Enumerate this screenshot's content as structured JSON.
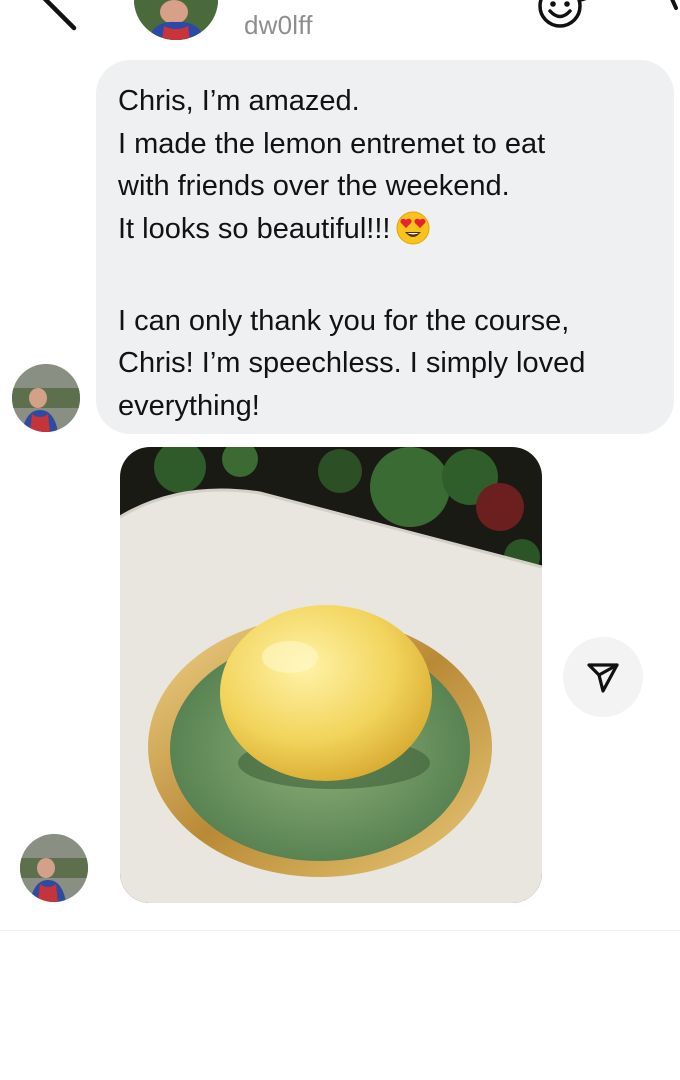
{
  "header": {
    "username": "dw0lff"
  },
  "message": {
    "text": "Chris, I’m amazed.\nI made the lemon entremet to eat\nwith friends over the weekend.\nIt looks so beautiful!!!",
    "emoji": "heart-eyes-emoji",
    "text2": "I can only thank you for the course,\nChris! I’m speechless. I simply loved\neverything!"
  },
  "photo": {
    "icon": "lemon-entremet-photo"
  },
  "icons": {
    "back": "back-arrow-icon",
    "sticker": "sticker-icon",
    "share": "share-icon"
  },
  "colors": {
    "bubble": "#eff0f2",
    "username": "#8e8e8e",
    "text": "#121212"
  }
}
